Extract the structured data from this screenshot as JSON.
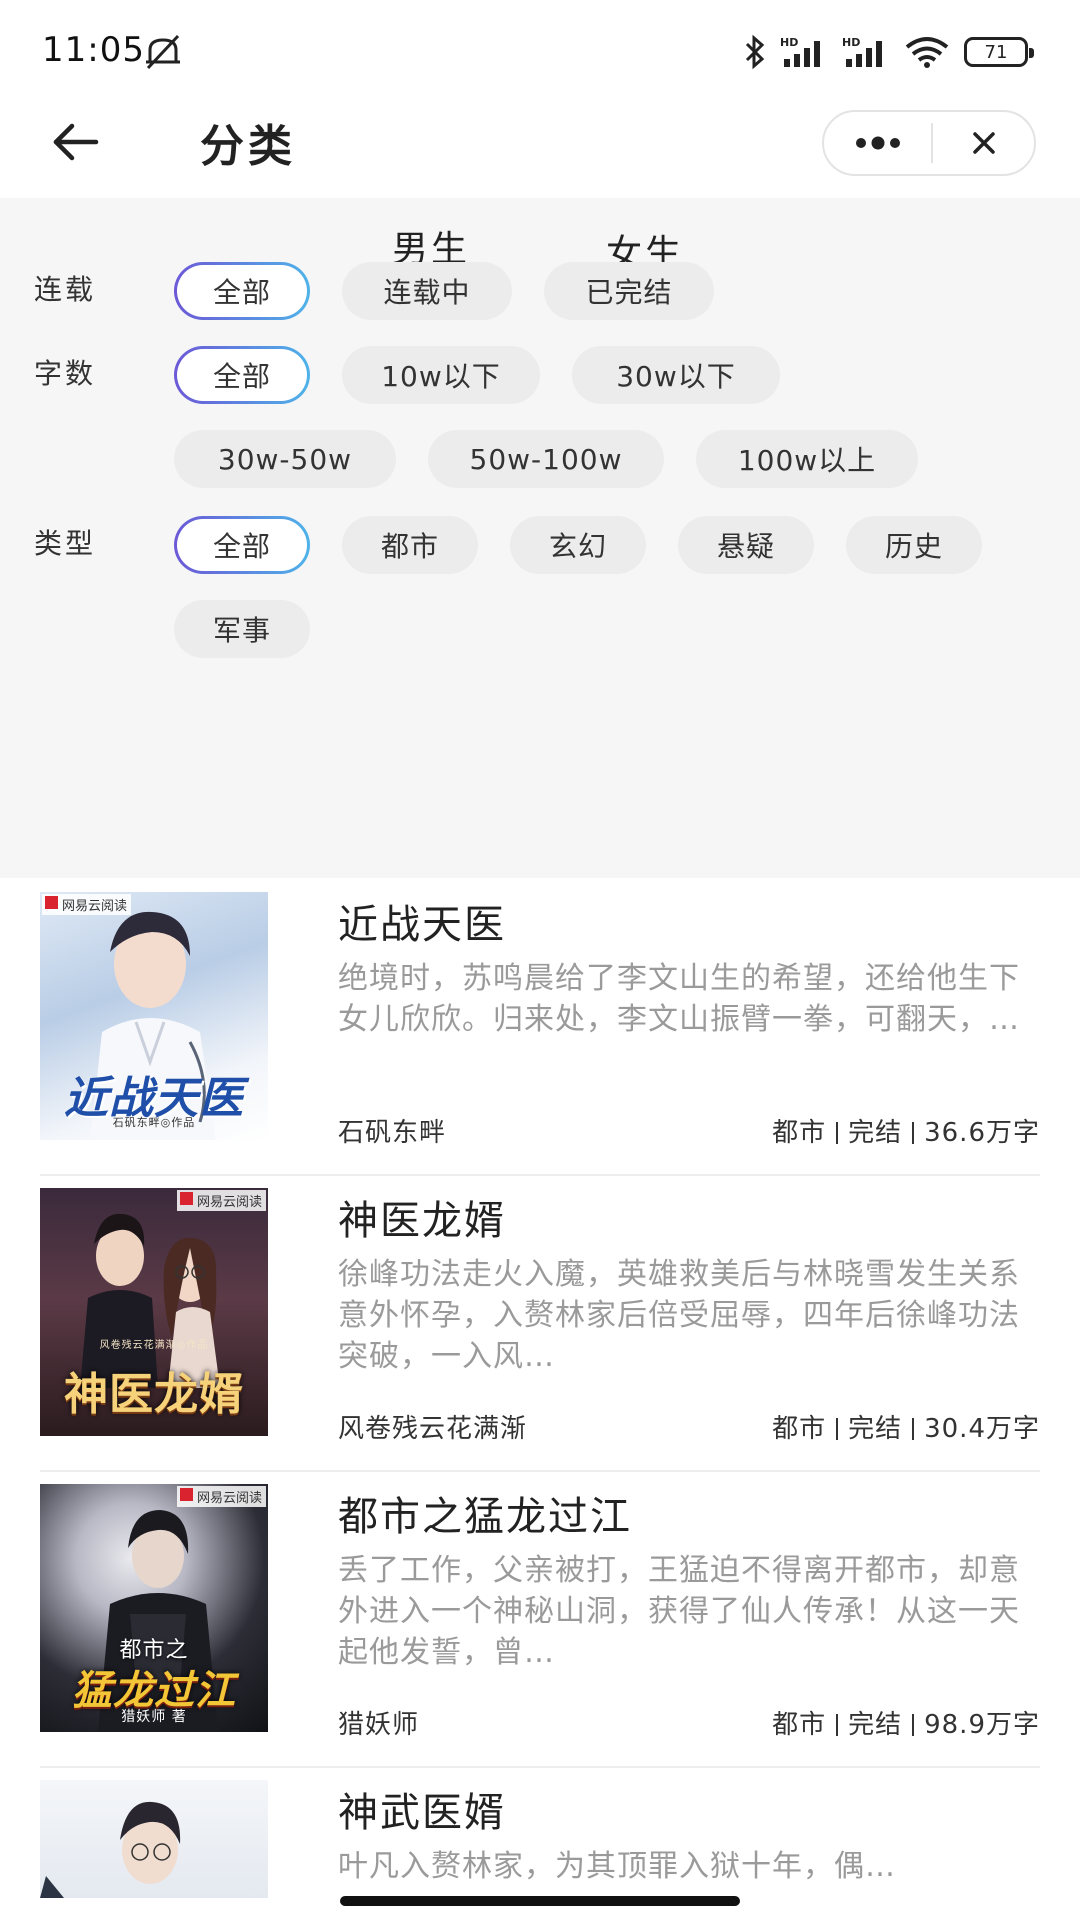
{
  "status_bar": {
    "time": "11:05",
    "battery": "71",
    "icons": [
      "mute-icon",
      "bluetooth-icon",
      "signal-hd-icon",
      "signal-hd-icon",
      "wifi-icon",
      "battery-icon"
    ]
  },
  "header": {
    "title": "分类",
    "back_icon": "arrow-left-icon",
    "more_icon": "more-dots-icon",
    "close_icon": "close-icon"
  },
  "tabs": [
    {
      "label": "男生",
      "active": true
    },
    {
      "label": "女生",
      "active": false
    }
  ],
  "filters": {
    "status": {
      "label": "连载",
      "options": [
        "全部",
        "连载中",
        "已完结"
      ],
      "selected": "全部"
    },
    "words": {
      "label": "字数",
      "options": [
        "全部",
        "10w以下",
        "30w以下",
        "30w-50w",
        "50w-100w",
        "100w以上"
      ],
      "selected": "全部"
    },
    "genre": {
      "label": "类型",
      "options": [
        "全部",
        "都市",
        "玄幻",
        "悬疑",
        "历史",
        "军事"
      ],
      "selected": "全部"
    }
  },
  "books": [
    {
      "title": "近战天医",
      "desc": "绝境时，苏鸣晨给了李文山生的希望，还给他生下女儿欣欣。归来处，李文山振臂一拳，可翻天，…",
      "author": "石矾东畔",
      "genre": "都市",
      "status": "完结",
      "words": "36.6万字",
      "cover_title": "近战天医",
      "cover_sub": "石矾东畔◎作品",
      "cover_logo": "网易云阅读"
    },
    {
      "title": "神医龙婿",
      "desc": "徐峰功法走火入魔，英雄救美后与林晓雪发生关系意外怀孕，入赘林家后倍受屈辱，四年后徐峰功法突破，一入风…",
      "author": "风卷残云花满渐",
      "genre": "都市",
      "status": "完结",
      "words": "30.4万字",
      "cover_title": "神医龙婿",
      "cover_sub": "风卷残云花满渐◎作品",
      "cover_logo": "网易云阅读"
    },
    {
      "title": "都市之猛龙过江",
      "desc": "丢了工作，父亲被打，王猛迫不得离开都市，却意外进入一个神秘山洞，获得了仙人传承！从这一天起他发誓，曾…",
      "author": "猎妖师",
      "genre": "都市",
      "status": "完结",
      "words": "98.9万字",
      "cover_title": "猛龙过江",
      "cover_top": "都市之",
      "cover_sub": "猎妖师 著",
      "cover_logo": "网易云阅读"
    },
    {
      "title": "神武医婿",
      "desc": "叶凡入赘林家，为其顶罪入狱十年，偶…",
      "author": "",
      "genre": "",
      "status": "",
      "words": "",
      "cover_title": "",
      "cover_logo": ""
    }
  ]
}
